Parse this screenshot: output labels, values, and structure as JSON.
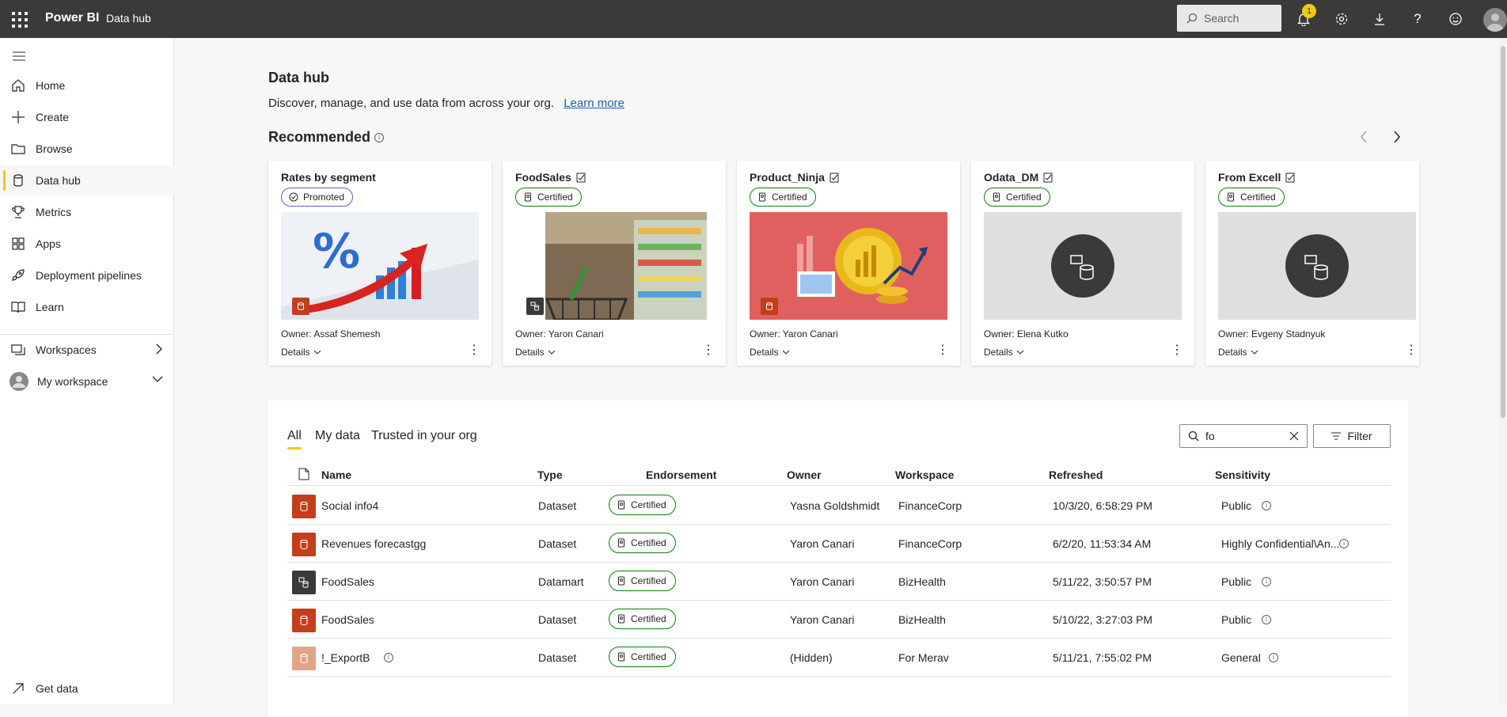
{
  "topbar": {
    "brand": "Power BI",
    "breadcrumb": "Data hub",
    "search_placeholder": "Search",
    "notification_count": "1"
  },
  "sidebar": {
    "items": [
      {
        "label": "Home",
        "icon": "home-icon"
      },
      {
        "label": "Create",
        "icon": "plus-icon"
      },
      {
        "label": "Browse",
        "icon": "folder-icon"
      },
      {
        "label": "Data hub",
        "icon": "database-icon",
        "active": true
      },
      {
        "label": "Metrics",
        "icon": "trophy-icon"
      },
      {
        "label": "Apps",
        "icon": "apps-icon"
      },
      {
        "label": "Deployment pipelines",
        "icon": "rocket-icon"
      },
      {
        "label": "Learn",
        "icon": "book-icon"
      }
    ],
    "workspaces_label": "Workspaces",
    "my_workspace_label": "My workspace",
    "get_data_label": "Get data"
  },
  "header": {
    "title": "Data hub",
    "subtitle": "Discover, manage, and use data from across your org.",
    "learn_more": "Learn more",
    "recommended": "Recommended"
  },
  "cards": [
    {
      "title": "Rates by segment",
      "endorsement": "Promoted",
      "owner": "Owner: Assaf Shemesh",
      "details": "Details"
    },
    {
      "title": "FoodSales",
      "endorsement": "Certified",
      "owner": "Owner: Yaron Canari",
      "details": "Details"
    },
    {
      "title": "Product_Ninja",
      "endorsement": "Certified",
      "owner": "Owner: Yaron Canari",
      "details": "Details"
    },
    {
      "title": "Odata_DM",
      "endorsement": "Certified",
      "owner": "Owner: Elena Kutko",
      "details": "Details"
    },
    {
      "title": "From Excell",
      "endorsement": "Certified",
      "owner": "Owner: Evgeny Stadnyuk",
      "details": "Details"
    }
  ],
  "tabs": {
    "all": "All",
    "my_data": "My data",
    "trusted": "Trusted in your org"
  },
  "filter": {
    "search_value": "fo",
    "button": "Filter"
  },
  "table": {
    "headers": {
      "name": "Name",
      "type": "Type",
      "endorsement": "Endorsement",
      "owner": "Owner",
      "workspace": "Workspace",
      "refreshed": "Refreshed",
      "sensitivity": "Sensitivity"
    },
    "rows": [
      {
        "name": "Social info4",
        "type": "Dataset",
        "endorsement": "Certified",
        "owner": "Yasna Goldshmidt",
        "workspace": "FinanceCorp",
        "refreshed": "10/3/20, 6:58:29 PM",
        "sensitivity": "Public",
        "icon_color": "#c43e1c"
      },
      {
        "name": "Revenues forecastgg",
        "type": "Dataset",
        "endorsement": "Certified",
        "owner": "Yaron Canari",
        "workspace": "FinanceCorp",
        "refreshed": "6/2/20, 11:53:34 AM",
        "sensitivity": "Highly Confidential\\An...",
        "icon_color": "#c43e1c"
      },
      {
        "name": "FoodSales",
        "type": "Datamart",
        "endorsement": "Certified",
        "owner": "Yaron Canari",
        "workspace": "BizHealth",
        "refreshed": "5/11/22, 3:50:57 PM",
        "sensitivity": "Public",
        "icon_color": "#3b3a39"
      },
      {
        "name": "FoodSales",
        "type": "Dataset",
        "endorsement": "Certified",
        "owner": "Yaron Canari",
        "workspace": "BizHealth",
        "refreshed": "5/10/22, 3:27:03 PM",
        "sensitivity": "Public",
        "icon_color": "#c43e1c"
      },
      {
        "name": "!_ExportB",
        "type": "Dataset",
        "endorsement": "Certified",
        "owner": "(Hidden)",
        "workspace": "For Merav",
        "refreshed": "5/11/21, 7:55:02 PM",
        "sensitivity": "General",
        "icon_color": "#e0a589"
      }
    ]
  },
  "colors": {
    "accent": "#f2c811",
    "certified": "#107c10",
    "promoted": "#5b5fc7",
    "dataset": "#c43e1c",
    "topbar": "#3b3a39"
  }
}
